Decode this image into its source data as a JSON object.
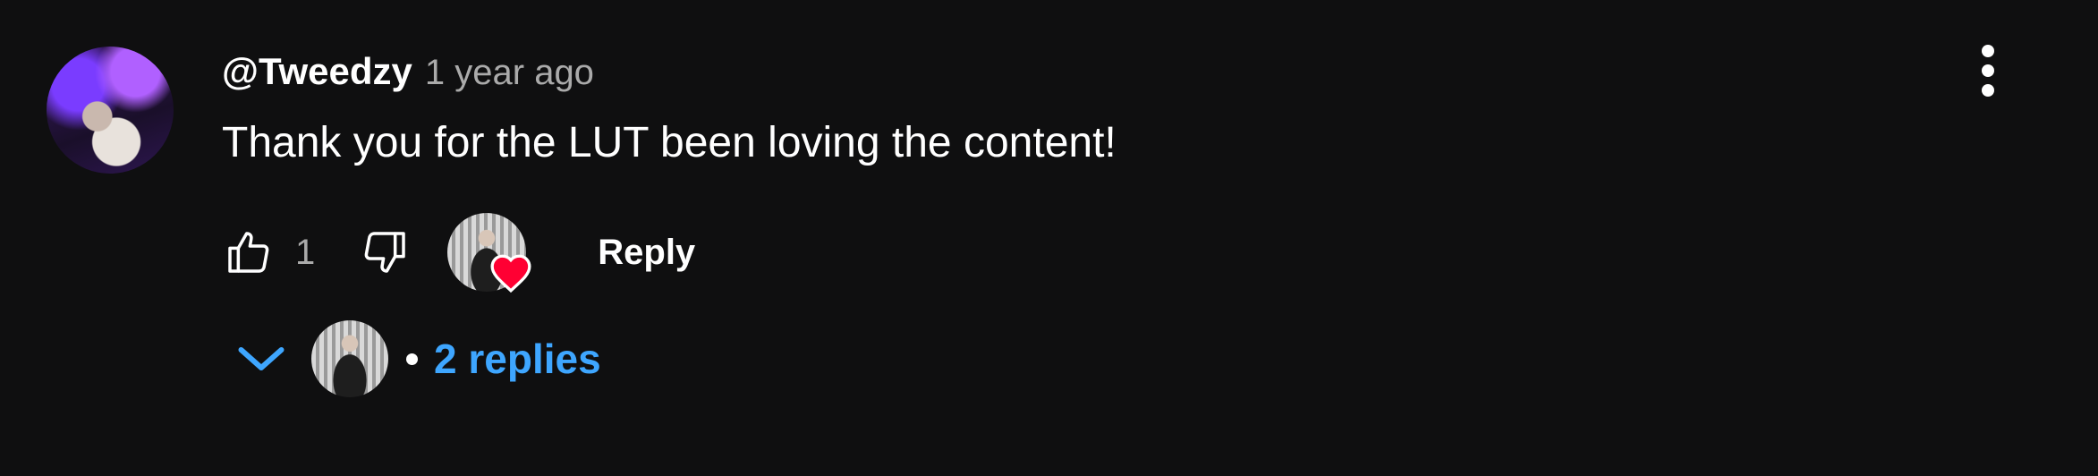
{
  "comment": {
    "author": "@Tweedzy",
    "timestamp": "1 year ago",
    "text": "Thank you for the LUT been loving the content!",
    "like_count": "1",
    "reply_label": "Reply",
    "replies_label": "2 replies"
  },
  "icons": {
    "like": "thumbs-up-icon",
    "dislike": "thumbs-down-icon",
    "more": "more-vert-icon",
    "expand": "chevron-down-icon",
    "heart": "heart-icon"
  },
  "colors": {
    "background": "#0f0f10",
    "accent": "#3ea6ff",
    "heart": "#ff0033",
    "muted": "#aaaaaa"
  }
}
